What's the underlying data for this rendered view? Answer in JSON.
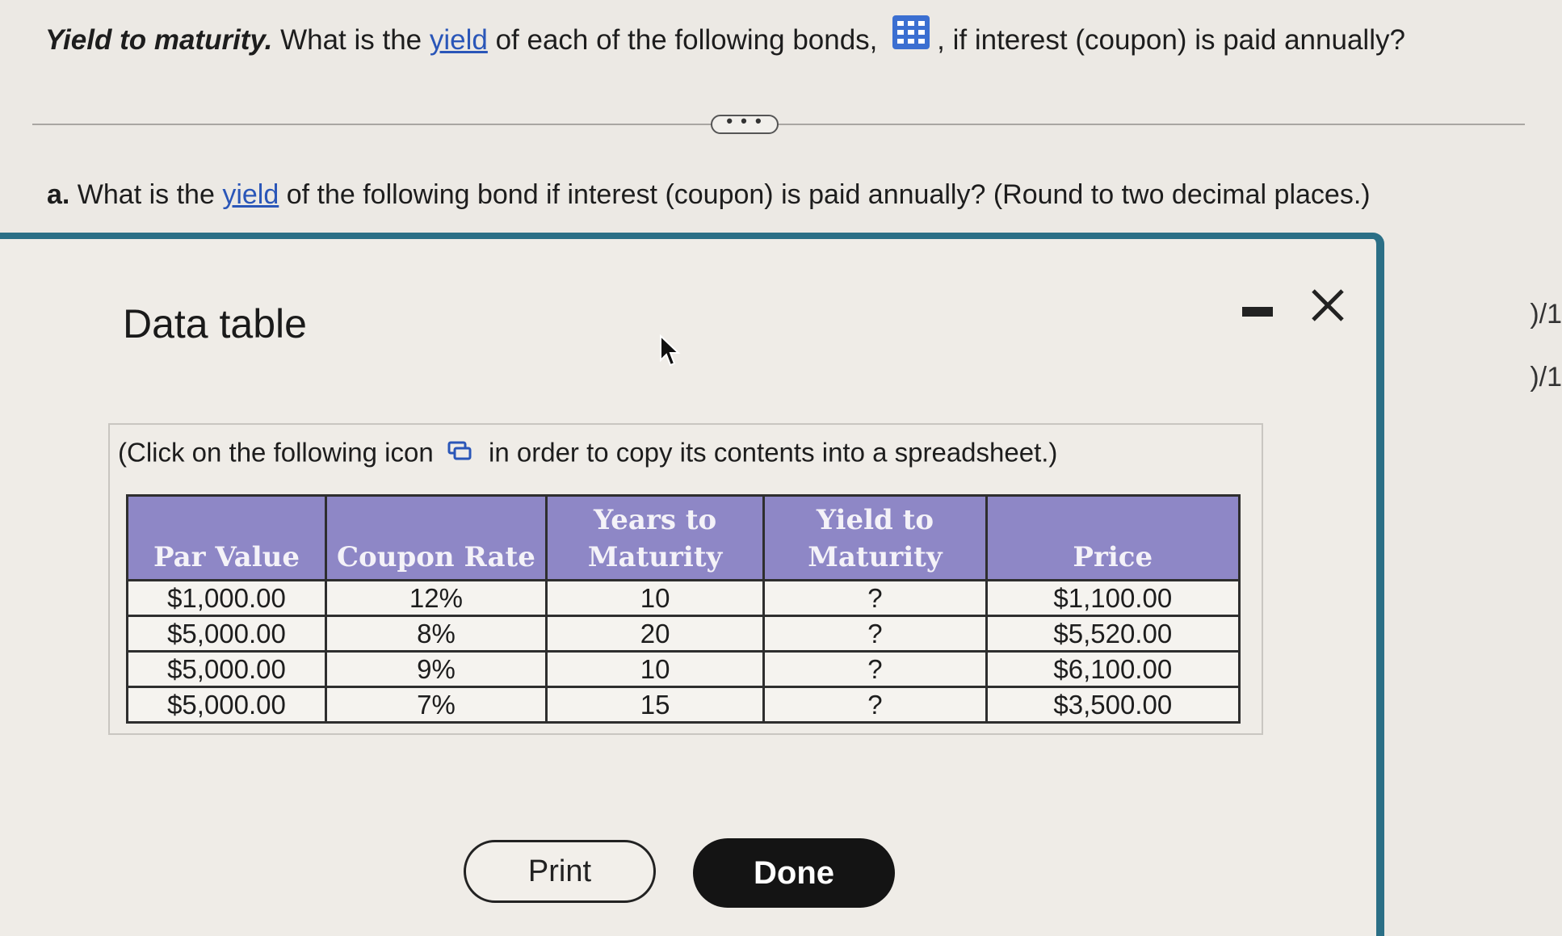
{
  "question": {
    "title_bold": "Yield to maturity.",
    "text_before_link": " What is the ",
    "link": "yield",
    "text_after_link": " of each of the following bonds,",
    "text_end": ", if interest (coupon) is paid annually?"
  },
  "expand_label": "• • •",
  "part_a": {
    "prefix": "a.",
    "text_before_link": " What is the ",
    "link": "yield",
    "text_after_link": " of the following bond if interest (coupon) is paid annually?  (Round to two decimal places.)"
  },
  "side_fractions": [
    ")/1",
    ")/1"
  ],
  "modal": {
    "title": "Data table",
    "copy_instruction_before": "(Click on the following icon",
    "copy_instruction_after": "in order to copy its contents into a spreadsheet.)",
    "columns": [
      "Par Value",
      "Coupon Rate",
      "Years to Maturity",
      "Yield to Maturity",
      "Price"
    ],
    "rows": [
      [
        "$1,000.00",
        "12%",
        "10",
        "?",
        "$1,100.00"
      ],
      [
        "$5,000.00",
        "8%",
        "20",
        "?",
        "$5,520.00"
      ],
      [
        "$5,000.00",
        "9%",
        "10",
        "?",
        "$6,100.00"
      ],
      [
        "$5,000.00",
        "7%",
        "15",
        "?",
        "$3,500.00"
      ]
    ],
    "print_label": "Print",
    "done_label": "Done"
  },
  "colors": {
    "header_bg": "#8e87c6",
    "modal_border": "#2b6f86",
    "link": "#2a56b8"
  }
}
